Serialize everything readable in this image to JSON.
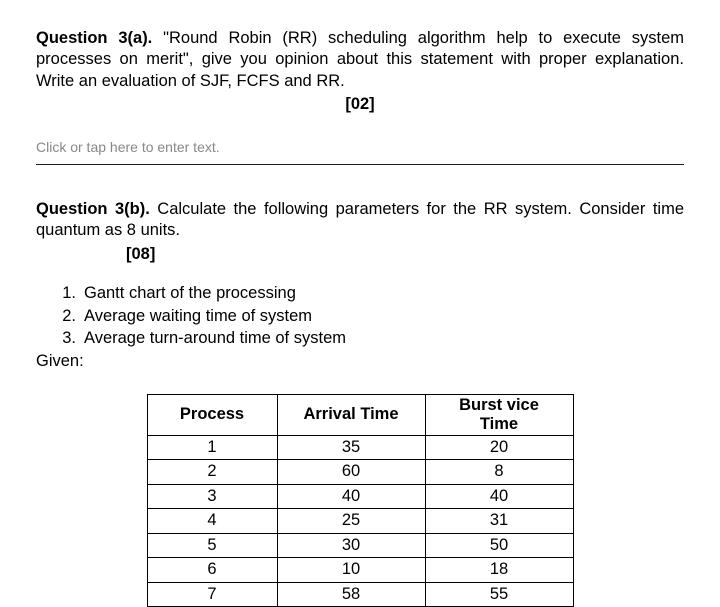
{
  "q3a": {
    "label": "Question 3(a).",
    "text": " \"Round Robin (RR) scheduling algorithm help to execute system processes on merit\", give you opinion about this statement with proper explanation. Write an evaluation of SJF, FCFS and RR.",
    "marks": "[02]"
  },
  "placeholder": "Click or tap here to enter text.",
  "q3b": {
    "label": "Question 3(b).",
    "text": " Calculate the following parameters for the RR system. Consider time quantum as 8 units.",
    "marks": "[08]"
  },
  "list": {
    "item1": "Gantt chart of the processing",
    "item2": "Average waiting time of system",
    "item3": "Average turn-around time of system"
  },
  "given": "Given:",
  "table": {
    "headers": {
      "process": "Process",
      "arrival": "Arrival Time",
      "burst_line1": "Burst vice",
      "burst_line2": "Time"
    },
    "rows": [
      {
        "p": "1",
        "a": "35",
        "b": "20"
      },
      {
        "p": "2",
        "a": "60",
        "b": "8"
      },
      {
        "p": "3",
        "a": "40",
        "b": "40"
      },
      {
        "p": "4",
        "a": "25",
        "b": "31"
      },
      {
        "p": "5",
        "a": "30",
        "b": "50"
      },
      {
        "p": "6",
        "a": "10",
        "b": "18"
      },
      {
        "p": "7",
        "a": "58",
        "b": "55"
      }
    ]
  }
}
